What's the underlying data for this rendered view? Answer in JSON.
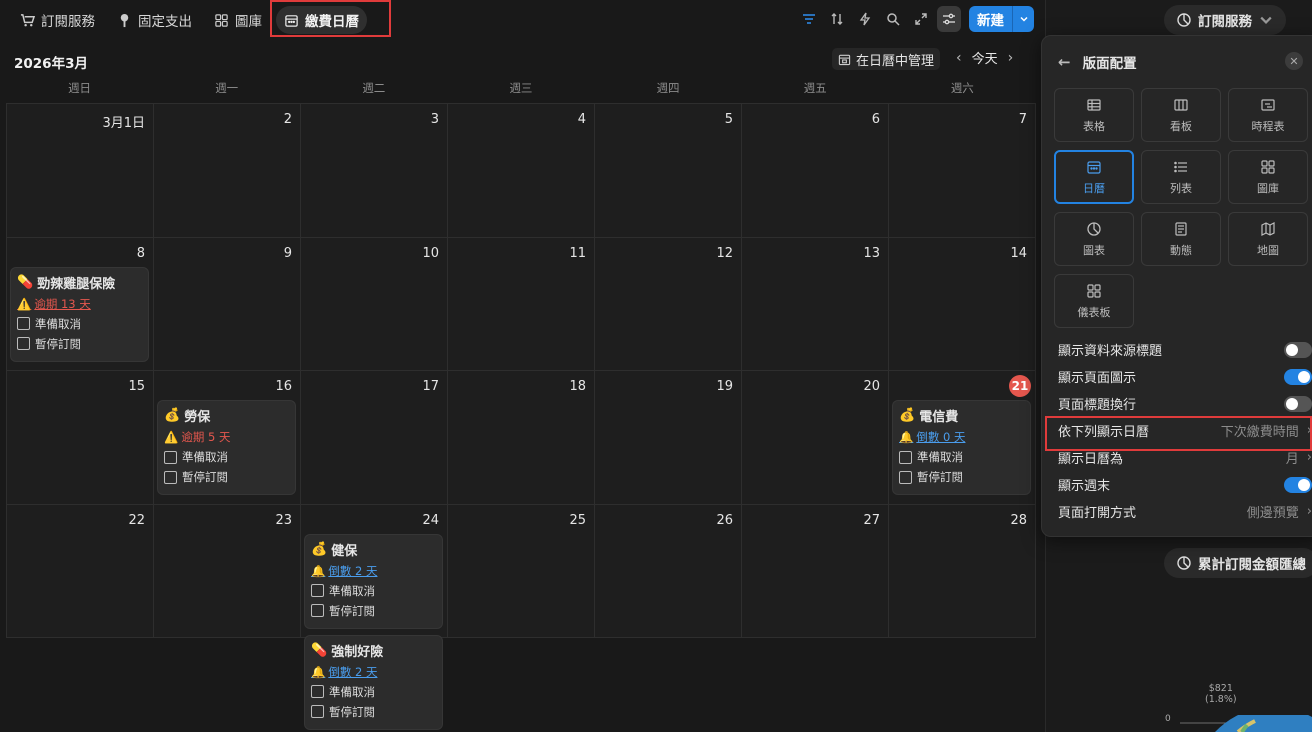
{
  "tabs": [
    {
      "label": "訂閱服務",
      "icon": "cart-icon"
    },
    {
      "label": "固定支出",
      "icon": "pin-icon"
    },
    {
      "label": "圖庫",
      "icon": "gallery-icon"
    },
    {
      "label": "繳費日曆",
      "icon": "calendar-icon"
    }
  ],
  "toolbar": {
    "new_label": "新建"
  },
  "header": {
    "month": "2026年3月",
    "manage": "在日曆中管理",
    "today": "今天"
  },
  "weekdays": [
    "週日",
    "週一",
    "週二",
    "週三",
    "週四",
    "週五",
    "週六"
  ],
  "weeks": [
    [
      "3月1日",
      "2",
      "3",
      "4",
      "5",
      "6",
      "7"
    ],
    [
      "8",
      "9",
      "10",
      "11",
      "12",
      "13",
      "14"
    ],
    [
      "15",
      "16",
      "17",
      "18",
      "19",
      "20",
      "21"
    ],
    [
      "22",
      "23",
      "24",
      "25",
      "26",
      "27",
      "28"
    ]
  ],
  "cards": {
    "c1": {
      "title": "勁辣雞腿保險",
      "status": "逾期 13 天",
      "opt1": "準備取消",
      "opt2": "暫停訂閱"
    },
    "c2": {
      "title": "勞保",
      "status": "逾期 5 天",
      "opt1": "準備取消",
      "opt2": "暫停訂閱"
    },
    "c3": {
      "title": "電信費",
      "status": "倒數 0 天",
      "opt1": "準備取消",
      "opt2": "暫停訂閱"
    },
    "c4": {
      "title": "健保",
      "status": "倒數 2 天",
      "opt1": "準備取消",
      "opt2": "暫停訂閱"
    },
    "c5": {
      "title": "強制好險",
      "status": "倒數 2 天",
      "opt1": "準備取消",
      "opt2": "暫停訂閱"
    }
  },
  "side": {
    "top_pill": "訂閱服務",
    "bottom_pill": "累計訂閱金額匯總",
    "donut_label_1": "$821",
    "donut_label_2": "(1.8%)",
    "donut_zero": "0"
  },
  "panel": {
    "title": "版面配置",
    "views": [
      "表格",
      "看板",
      "時程表",
      "日曆",
      "列表",
      "圖庫",
      "圖表",
      "動態",
      "地圖",
      "儀表板"
    ],
    "settings": [
      {
        "label": "顯示資料來源標題"
      },
      {
        "label": "顯示頁面圖示"
      },
      {
        "label": "頁面標題換行"
      },
      {
        "label": "依下列顯示日曆",
        "value": "下次繳費時間"
      },
      {
        "label": "顯示日曆為",
        "value": "月"
      },
      {
        "label": "顯示週末"
      },
      {
        "label": "頁面打開方式",
        "value": "側邊預覽"
      }
    ]
  },
  "colors": {
    "accent": "#2383e2",
    "overdue": "#e5574e",
    "countdown": "#4a9ded",
    "highlight": "#e03b3b"
  }
}
